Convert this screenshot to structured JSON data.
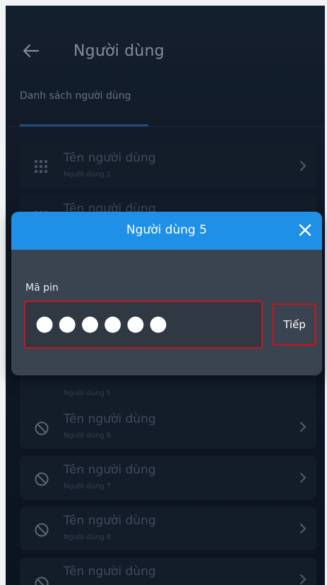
{
  "header": {
    "back_icon": "arrow-left-icon",
    "title": "Người dùng",
    "tab_label": "Danh sách người dùng"
  },
  "users": [
    {
      "name": "Tên người dùng",
      "sub": "Người dùng 1",
      "icon": "keypad-icon"
    },
    {
      "name": "Tên người dùng",
      "sub": "",
      "icon": "keypad-icon"
    },
    {
      "name": "",
      "sub": "Người dùng 5",
      "icon": ""
    },
    {
      "name": "Tên người dùng",
      "sub": "Người dùng 6",
      "icon": "block-icon"
    },
    {
      "name": "Tên người dùng",
      "sub": "Người dùng 7",
      "icon": "block-icon"
    },
    {
      "name": "Tên người dùng",
      "sub": "Người dùng 8",
      "icon": "block-icon"
    },
    {
      "name": "Tên người dùng",
      "sub": "",
      "icon": "block-icon"
    }
  ],
  "dialog": {
    "title": "Người dùng 5",
    "pin_label": "Mã pin",
    "pin_value": "●●●●●●",
    "next_label": "Tiếp",
    "header_color": "#1e90e6",
    "highlight_color": "#c9151c"
  }
}
